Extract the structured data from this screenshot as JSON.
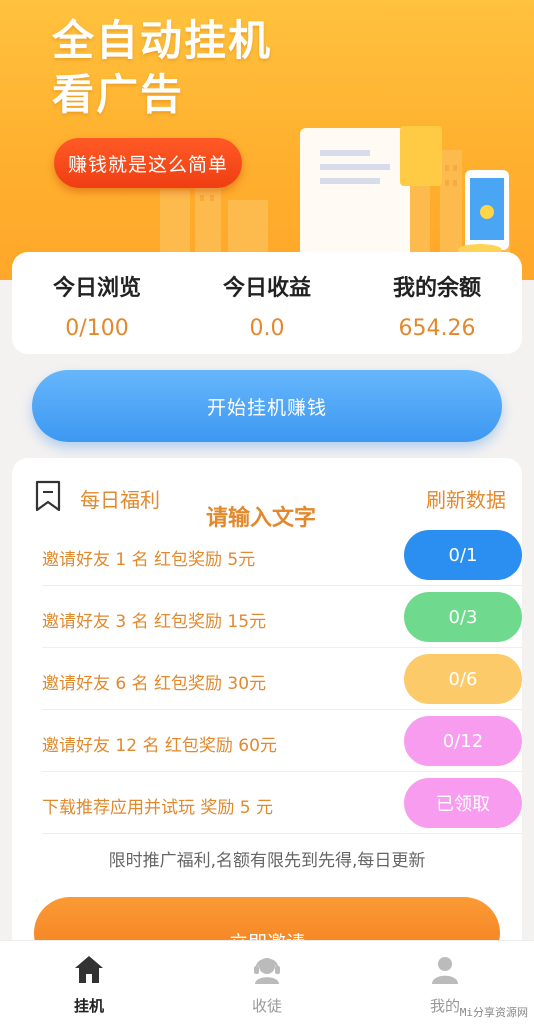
{
  "banner": {
    "title_line1": "全自动挂机",
    "title_line2": "看广告",
    "button_label": "赚钱就是这么简单"
  },
  "stats": [
    {
      "label": "今日浏览",
      "value": "0/100"
    },
    {
      "label": "今日收益",
      "value": "0.0"
    },
    {
      "label": "我的余额",
      "value": "654.26"
    }
  ],
  "start_button": "开始挂机赚钱",
  "welfare": {
    "title": "每日福利",
    "placeholder": "请输入文字",
    "refresh": "刷新数据",
    "tasks": [
      {
        "text": "邀请好友 1 名 红包奖励 5元",
        "status": "0/1",
        "color": "#2a8ff0"
      },
      {
        "text": "邀请好友 3 名 红包奖励 15元",
        "status": "0/3",
        "color": "#6fd98d"
      },
      {
        "text": "邀请好友 6 名 红包奖励 30元",
        "status": "0/6",
        "color": "#fdca6a"
      },
      {
        "text": "邀请好友 12 名 红包奖励 60元",
        "status": "0/12",
        "color": "#f89cf0"
      },
      {
        "text": "下载推荐应用并试玩 奖励 5 元",
        "status": "已领取",
        "color": "#f89cf0"
      }
    ],
    "note": "限时推广福利,名额有限先到先得,每日更新"
  },
  "invite_button": "立即邀请",
  "nav": {
    "items": [
      {
        "label": "挂机",
        "icon": "home-icon",
        "active": true
      },
      {
        "label": "收徒",
        "icon": "headset-icon",
        "active": false
      },
      {
        "label": "我的",
        "icon": "user-icon",
        "active": false
      }
    ]
  },
  "watermark": "Mi分享资源网"
}
